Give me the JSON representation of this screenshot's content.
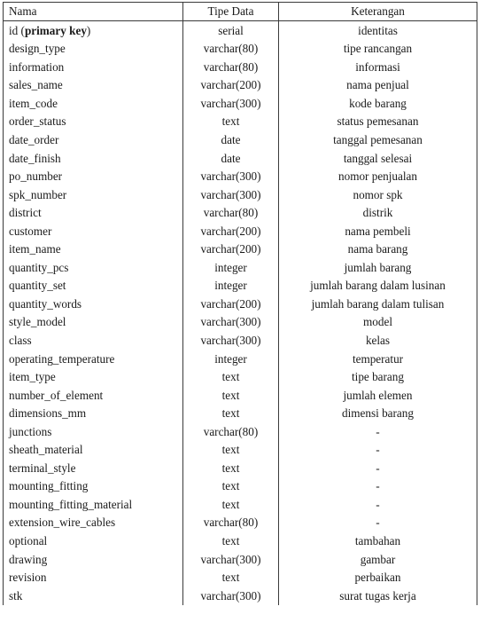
{
  "table": {
    "headers": [
      "Nama",
      "Tipe Data",
      "Keterangan"
    ],
    "rows": [
      {
        "nama": "id (primary key)",
        "nama_prefix": "id (",
        "nama_bold": "primary key",
        "nama_suffix": ")",
        "tipe": "serial",
        "keterangan": "identitas"
      },
      {
        "nama": "design_type",
        "tipe": "varchar(80)",
        "keterangan": "tipe rancangan"
      },
      {
        "nama": "information",
        "tipe": "varchar(80)",
        "keterangan": "informasi"
      },
      {
        "nama": "sales_name",
        "tipe": "varchar(200)",
        "keterangan": "nama penjual"
      },
      {
        "nama": "item_code",
        "tipe": "varchar(300)",
        "keterangan": "kode barang"
      },
      {
        "nama": "order_status",
        "tipe": "text",
        "keterangan": "status pemesanan"
      },
      {
        "nama": "date_order",
        "tipe": "date",
        "keterangan": "tanggal pemesanan"
      },
      {
        "nama": "date_finish",
        "tipe": "date",
        "keterangan": "tanggal selesai"
      },
      {
        "nama": "po_number",
        "tipe": "varchar(300)",
        "keterangan": "nomor penjualan"
      },
      {
        "nama": "spk_number",
        "tipe": "varchar(300)",
        "keterangan": "nomor spk"
      },
      {
        "nama": "district",
        "tipe": "varchar(80)",
        "keterangan": "distrik"
      },
      {
        "nama": "customer",
        "tipe": "varchar(200)",
        "keterangan": "nama pembeli"
      },
      {
        "nama": "item_name",
        "tipe": "varchar(200)",
        "keterangan": "nama barang"
      },
      {
        "nama": "quantity_pcs",
        "tipe": "integer",
        "keterangan": "jumlah barang"
      },
      {
        "nama": "quantity_set",
        "tipe": "integer",
        "keterangan": "jumlah barang dalam lusinan"
      },
      {
        "nama": "quantity_words",
        "tipe": "varchar(200)",
        "keterangan": "jumlah barang dalam tulisan"
      },
      {
        "nama": "style_model",
        "tipe": "varchar(300)",
        "keterangan": "model"
      },
      {
        "nama": "class",
        "tipe": "varchar(300)",
        "keterangan": "kelas"
      },
      {
        "nama": "operating_temperature",
        "tipe": "integer",
        "keterangan": "temperatur"
      },
      {
        "nama": "item_type",
        "tipe": "text",
        "keterangan": "tipe barang"
      },
      {
        "nama": "number_of_element",
        "tipe": "text",
        "keterangan": "jumlah elemen"
      },
      {
        "nama": "dimensions_mm",
        "tipe": "text",
        "keterangan": "dimensi barang"
      },
      {
        "nama": "junctions",
        "tipe": "varchar(80)",
        "keterangan": "-"
      },
      {
        "nama": "sheath_material",
        "tipe": "text",
        "keterangan": "-"
      },
      {
        "nama": "terminal_style",
        "tipe": "text",
        "keterangan": "-"
      },
      {
        "nama": "mounting_fitting",
        "tipe": "text",
        "keterangan": "-"
      },
      {
        "nama": "mounting_fitting_material",
        "tipe": "text",
        "keterangan": "-"
      },
      {
        "nama": "extension_wire_cables",
        "tipe": "varchar(80)",
        "keterangan": "-"
      },
      {
        "nama": "optional",
        "tipe": "text",
        "keterangan": "tambahan"
      },
      {
        "nama": "drawing",
        "tipe": "varchar(300)",
        "keterangan": "gambar"
      },
      {
        "nama": "revision",
        "tipe": "text",
        "keterangan": "perbaikan"
      },
      {
        "nama": "stk",
        "tipe": "varchar(300)",
        "keterangan": "surat tugas kerja"
      }
    ]
  },
  "style": {
    "border_color": "#3a3a3a",
    "text_color": "#1a1a1a",
    "background": "#ffffff"
  }
}
